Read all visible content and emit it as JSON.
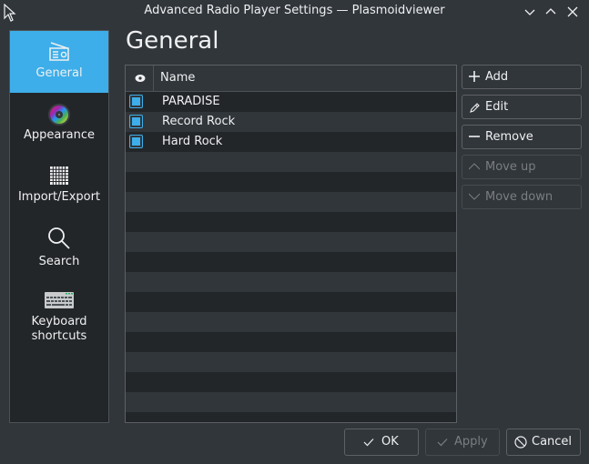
{
  "window": {
    "title": "Advanced Radio Player Settings — Plasmoidviewer",
    "controls": [
      "minimize",
      "maximize",
      "close"
    ]
  },
  "sidebar": {
    "items": [
      {
        "label": "General",
        "icon": "radio-icon",
        "active": true
      },
      {
        "label": "Appearance",
        "icon": "color-wheel-icon",
        "active": false
      },
      {
        "label": "Import/Export",
        "icon": "grid-icon",
        "active": false
      },
      {
        "label": "Search",
        "icon": "search-icon",
        "active": false
      },
      {
        "label": "Keyboard shortcuts",
        "label_line1": "Keyboard",
        "label_line2": "shortcuts",
        "icon": "keyboard-icon",
        "active": false
      }
    ]
  },
  "page": {
    "title": "General"
  },
  "table": {
    "columns": [
      {
        "label": "",
        "icon": "eye-icon"
      },
      {
        "label": "Name"
      }
    ],
    "rows": [
      {
        "checked": true,
        "name": "PARADISE"
      },
      {
        "checked": true,
        "name": "Record Rock"
      },
      {
        "checked": true,
        "name": "Hard Rock"
      }
    ]
  },
  "actions": {
    "add": "Add",
    "edit": "Edit",
    "remove": "Remove",
    "move_up": "Move up",
    "move_down": "Move down"
  },
  "footer": {
    "ok": "OK",
    "apply": "Apply",
    "cancel": "Cancel"
  },
  "colors": {
    "accent": "#3daee9",
    "window_bg": "#31363b",
    "view_bg": "#232629",
    "text": "#eff0f1"
  }
}
